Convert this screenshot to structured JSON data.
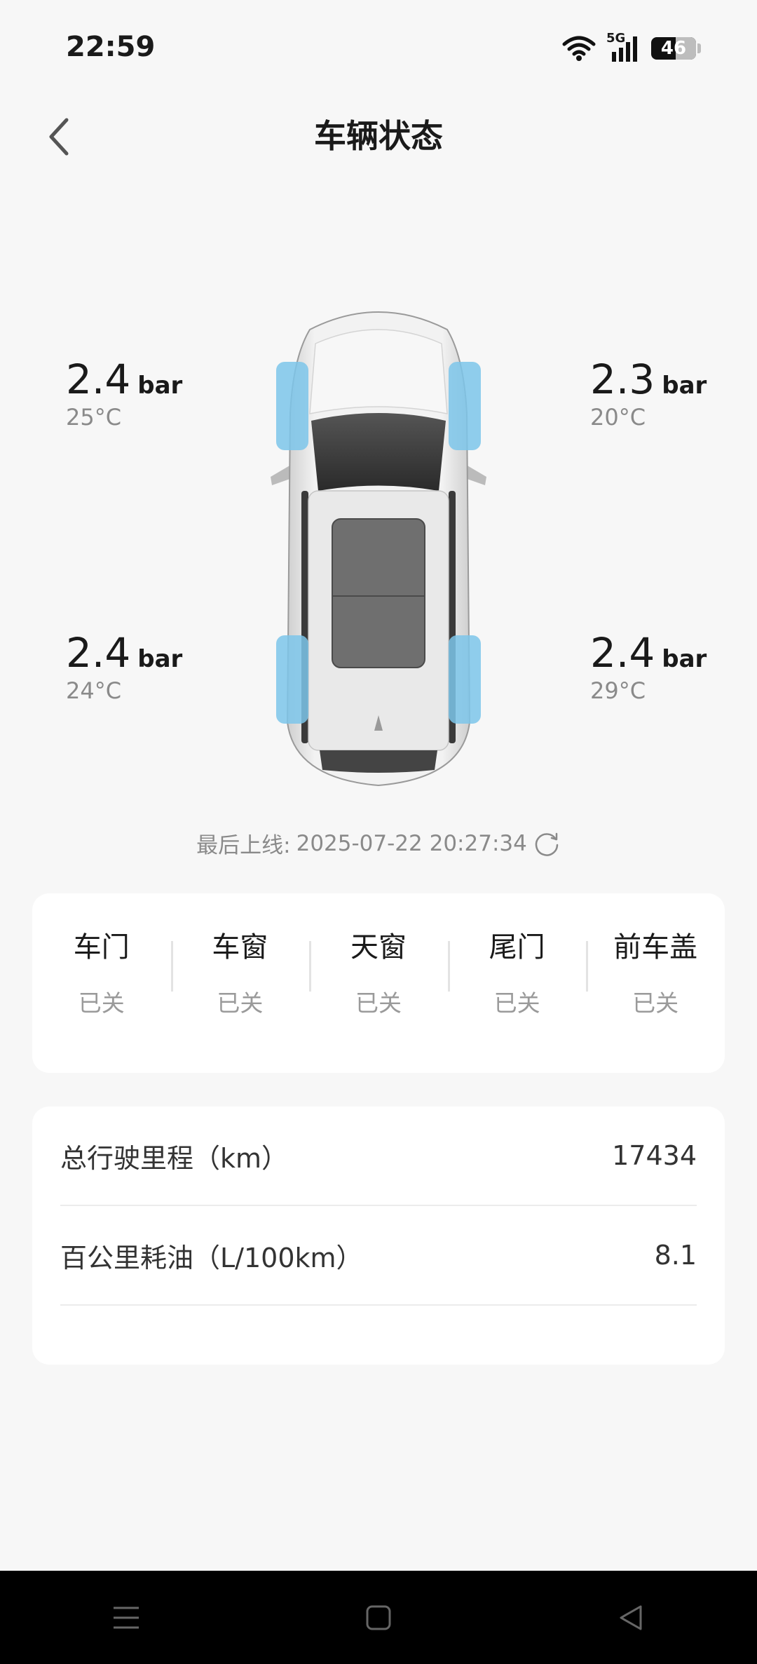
{
  "status_bar": {
    "time": "22:59",
    "network": "5G",
    "battery": "46"
  },
  "header": {
    "title": "车辆状态",
    "back_icon": "chevron-left-icon"
  },
  "tires": {
    "front_left": {
      "pressure": "2.4",
      "unit": "bar",
      "temp": "25°C"
    },
    "front_right": {
      "pressure": "2.3",
      "unit": "bar",
      "temp": "20°C"
    },
    "rear_left": {
      "pressure": "2.4",
      "unit": "bar",
      "temp": "24°C"
    },
    "rear_right": {
      "pressure": "2.4",
      "unit": "bar",
      "temp": "29°C"
    }
  },
  "last_online": {
    "label": "最后上线:",
    "value": "2025-07-22 20:27:34",
    "icon": "refresh-icon"
  },
  "status_items": [
    {
      "label": "车门",
      "value": "已关"
    },
    {
      "label": "车窗",
      "value": "已关"
    },
    {
      "label": "天窗",
      "value": "已关"
    },
    {
      "label": "尾门",
      "value": "已关"
    },
    {
      "label": "前车盖",
      "value": "已关"
    }
  ],
  "info": [
    {
      "label": "总行驶里程（km）",
      "value": "17434"
    },
    {
      "label": "百公里耗油（L/100km）",
      "value": "8.1"
    }
  ],
  "colors": {
    "tire_highlight": "#7cc6ea",
    "background": "#f7f7f7",
    "nav_bar": "#000000"
  }
}
